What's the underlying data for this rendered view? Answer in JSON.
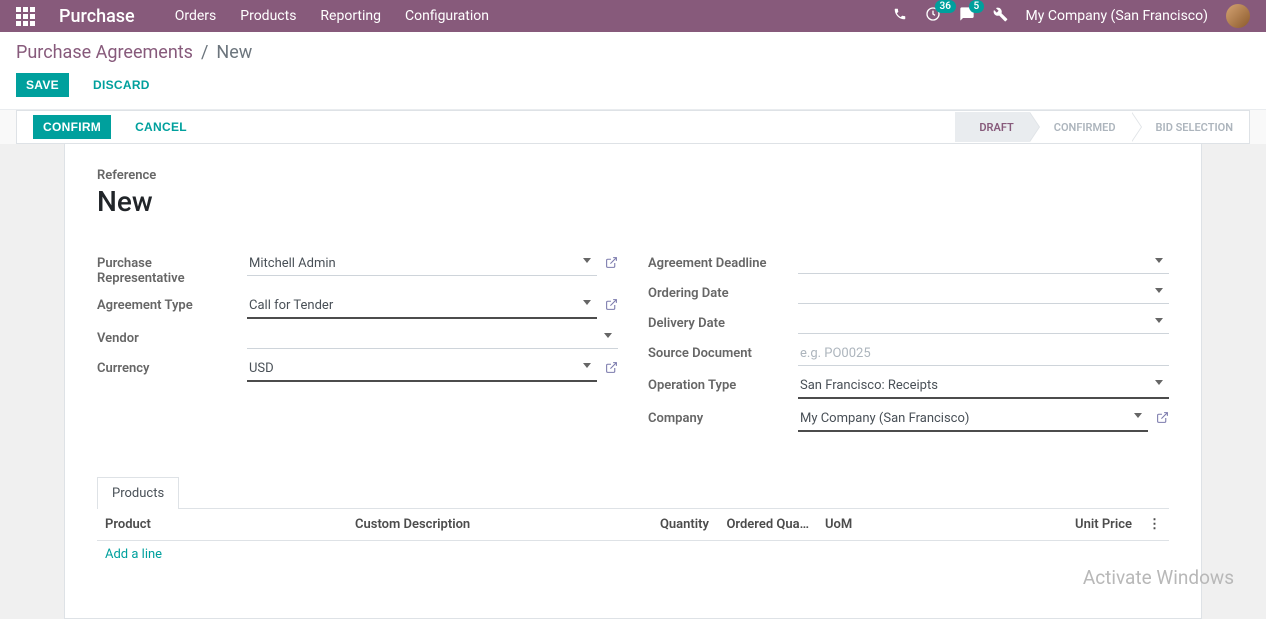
{
  "nav": {
    "brand": "Purchase",
    "menu": [
      "Orders",
      "Products",
      "Reporting",
      "Configuration"
    ],
    "activity_count": "36",
    "messages_count": "5",
    "company": "My Company (San Francisco)"
  },
  "breadcrumb": {
    "parent": "Purchase Agreements",
    "sep": "/",
    "current": "New"
  },
  "buttons": {
    "save": "Save",
    "discard": "Discard",
    "confirm": "Confirm",
    "cancel": "Cancel"
  },
  "status": {
    "steps": [
      "Draft",
      "Confirmed",
      "Bid Selection"
    ],
    "active_index": 0
  },
  "form": {
    "reference_label": "Reference",
    "title": "New",
    "left": {
      "purchase_rep_label": "Purchase Representative",
      "purchase_rep_value": "Mitchell Admin",
      "agreement_type_label": "Agreement Type",
      "agreement_type_value": "Call for Tender",
      "vendor_label": "Vendor",
      "vendor_value": "",
      "currency_label": "Currency",
      "currency_value": "USD"
    },
    "right": {
      "deadline_label": "Agreement Deadline",
      "ordering_label": "Ordering Date",
      "delivery_label": "Delivery Date",
      "source_label": "Source Document",
      "source_placeholder": "e.g. PO0025",
      "operation_label": "Operation Type",
      "operation_value": "San Francisco: Receipts",
      "company_label": "Company",
      "company_value": "My Company (San Francisco)"
    }
  },
  "tabs": {
    "products": "Products"
  },
  "table": {
    "headers": {
      "product": "Product",
      "desc": "Custom Description",
      "qty": "Quantity",
      "ordered": "Ordered Qua…",
      "uom": "UoM",
      "price": "Unit Price"
    },
    "add_line": "Add a line"
  },
  "watermark": "Activate Windows"
}
